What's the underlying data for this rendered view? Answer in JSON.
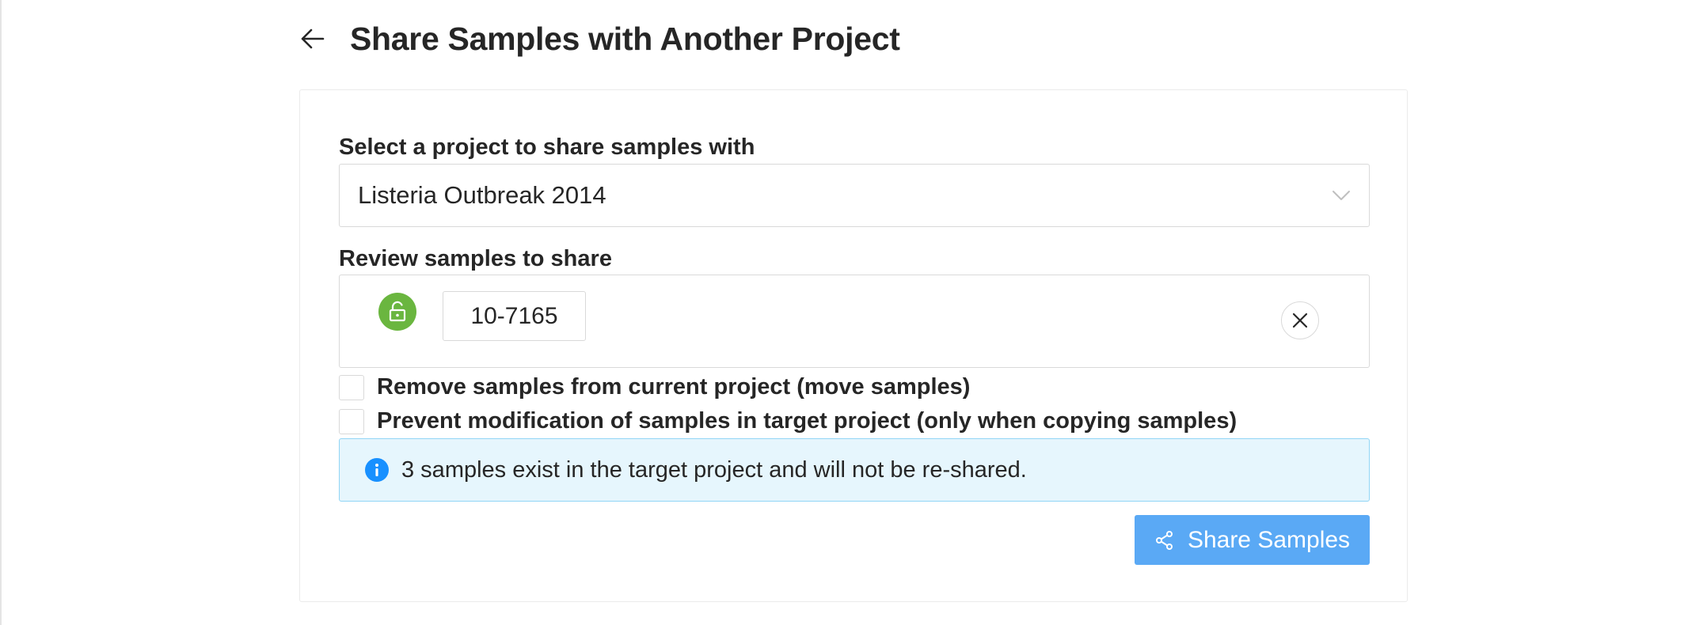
{
  "header": {
    "title": "Share Samples with Another Project"
  },
  "project_select": {
    "label": "Select a project to share samples with",
    "selected_value": "Listeria Outbreak 2014"
  },
  "samples_review": {
    "label": "Review samples to share",
    "samples": [
      {
        "name": "10-7165",
        "locked": false,
        "lock_color": "#6ab63f"
      }
    ]
  },
  "options": {
    "remove_samples": {
      "label": "Remove samples from current project (move samples)",
      "checked": false
    },
    "prevent_modification": {
      "label": "Prevent modification of samples in target project (only when copying samples)",
      "checked": false
    }
  },
  "alert": {
    "type": "info",
    "text": "3 samples exist in the target project and will not be re-shared.",
    "icon": "info-circle-icon"
  },
  "actions": {
    "share_label": "Share Samples",
    "share_icon": "share-icon"
  },
  "colors": {
    "primary": "#5aa9f5",
    "info_bg": "#e6f6fd",
    "info_border": "#91d5f5",
    "unlocked": "#6ab63f"
  }
}
